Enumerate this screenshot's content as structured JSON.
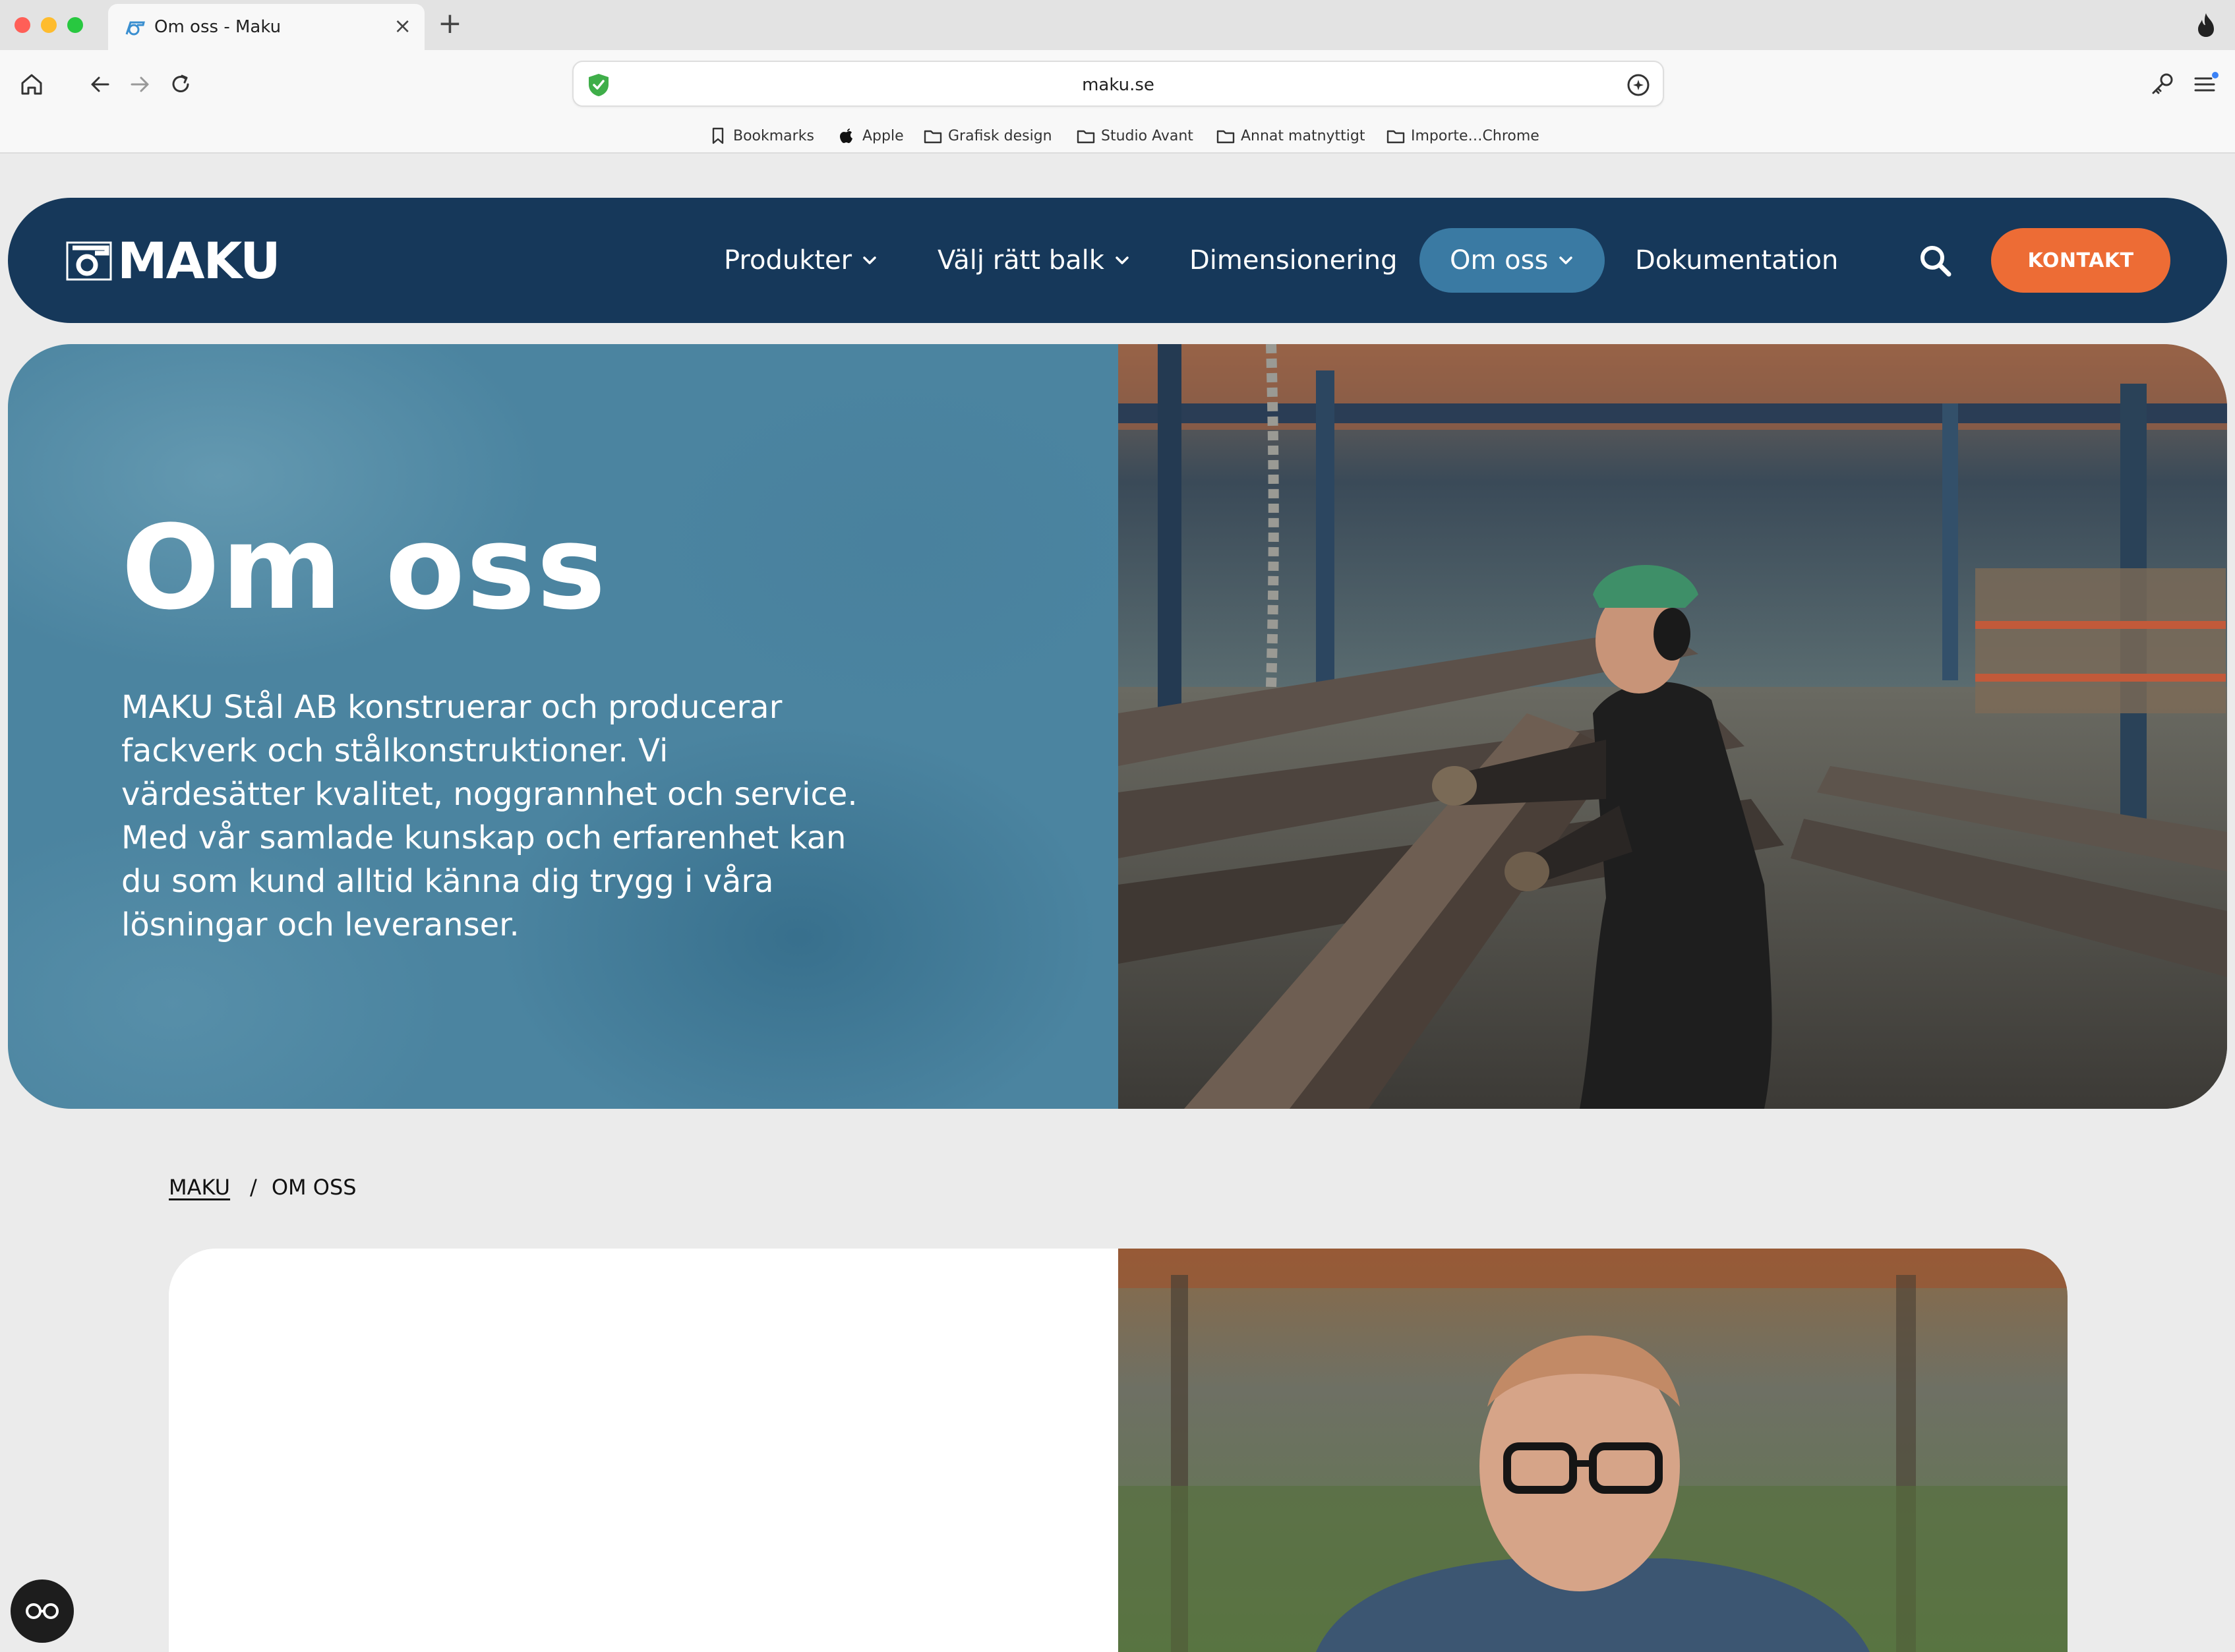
{
  "browser": {
    "tab_title": "Om oss - Maku",
    "close_glyph": "×",
    "new_tab_glyph": "+",
    "url": "maku.se",
    "bookmarks": [
      {
        "label": "Bookmarks",
        "icon": "bookmark-icon"
      },
      {
        "label": "Apple",
        "icon": "apple-icon"
      },
      {
        "label": "Grafisk design",
        "icon": "folder-icon"
      },
      {
        "label": "Studio Avant",
        "icon": "folder-icon"
      },
      {
        "label": "Annat matnyttigt",
        "icon": "folder-icon"
      },
      {
        "label": "Importe…Chrome",
        "icon": "folder-icon"
      }
    ]
  },
  "site": {
    "logo_text": "MAKU",
    "nav": {
      "items": [
        {
          "label": "Produkter",
          "has_dropdown": true
        },
        {
          "label": "Välj rätt balk",
          "has_dropdown": true
        },
        {
          "label": "Dimensionering",
          "has_dropdown": false
        },
        {
          "label": "Om oss",
          "has_dropdown": true,
          "active": true
        },
        {
          "label": "Dokumentation",
          "has_dropdown": false
        }
      ],
      "contact_label": "KONTAKT"
    },
    "hero": {
      "title": "Om oss",
      "text": "MAKU Stål AB konstruerar och producerar fackverk och stålkonstruktioner. Vi värdesätter kvalitet, noggrannhet och service. Med vår samlade kunskap och erfarenhet kan du som kund alltid känna dig trygg i våra lösningar och leveranser."
    },
    "breadcrumb": {
      "home": "MAKU",
      "separator": "/",
      "current": "OM OSS"
    }
  },
  "colors": {
    "nav_bg": "#16385a",
    "nav_active": "#3a7aa3",
    "contact_button": "#ed6c35",
    "hero_bg": "#4b84a0"
  }
}
